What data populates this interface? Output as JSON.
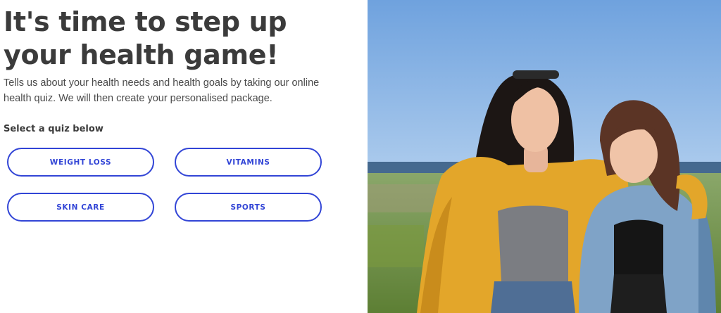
{
  "hero": {
    "headline": "It's time to step up your health game!",
    "intro": "Tells us about your health needs and health goals by taking our online health quiz. We will then create your personalised package.",
    "quiz_label": "Select a quiz below"
  },
  "quizzes": [
    {
      "label": "WEIGHT LOSS"
    },
    {
      "label": "VITAMINS"
    },
    {
      "label": "SKIN CARE"
    },
    {
      "label": "SPORTS"
    }
  ],
  "colors": {
    "accent": "#3245d6",
    "heading": "#3b3b3b",
    "body_text": "#4a4a4a"
  }
}
